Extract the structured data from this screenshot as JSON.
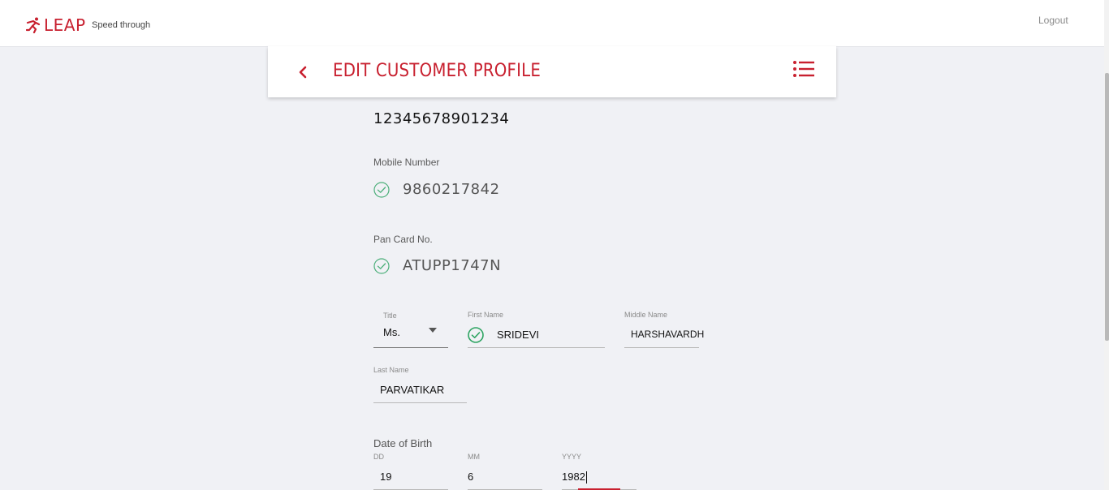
{
  "topbar": {
    "logo_text": "LEAP",
    "tagline": "Speed through",
    "logout_label": "Logout",
    "accent_color": "#c8202f"
  },
  "header": {
    "title": "EDIT CUSTOMER PROFILE",
    "back_icon": "chevron-left-icon",
    "menu_icon": "list-menu-icon"
  },
  "profile": {
    "account_number": "12345678901234",
    "mobile": {
      "label": "Mobile Number",
      "value": "9860217842",
      "verified": true
    },
    "pan": {
      "label": "Pan Card No.",
      "value": "ATUPP1747N",
      "verified": true
    }
  },
  "name": {
    "title_label": "Title",
    "title_value": "Ms.",
    "first_label": "First Name",
    "first_value": "SRIDEVI",
    "middle_label": "Middle Name",
    "middle_value": "HARSHAVARDH",
    "last_label": "Last Name",
    "last_value": "PARVATIKAR"
  },
  "dob": {
    "label": "Date of Birth",
    "dd_label": "DD",
    "dd_value": "19",
    "mm_label": "MM",
    "mm_value": "6",
    "yyyy_label": "YYYY",
    "yyyy_value": "1982"
  }
}
